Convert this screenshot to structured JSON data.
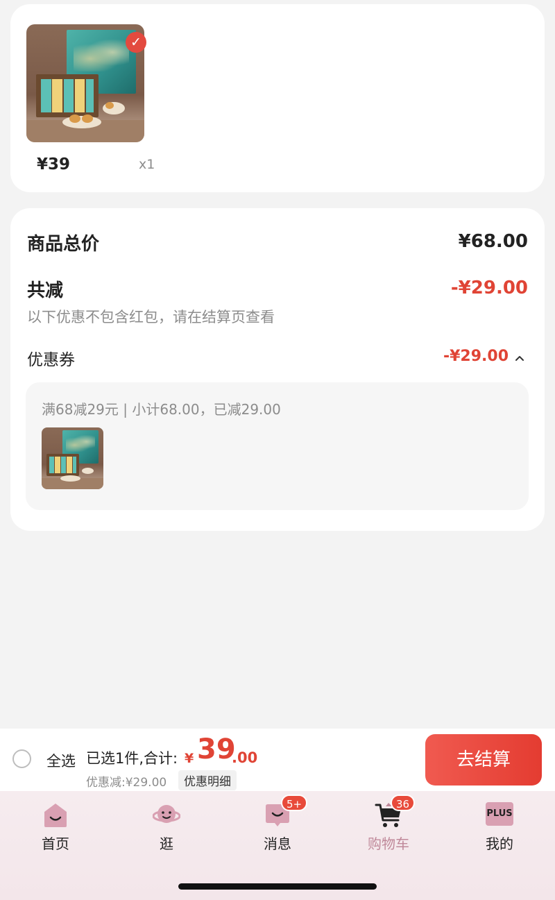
{
  "item": {
    "price": "¥39",
    "quantity": "x1",
    "checkmark": "✓"
  },
  "summary": {
    "total_label": "商品总价",
    "total_value": "¥68.00",
    "discount_label": "共减",
    "discount_value": "-¥29.00",
    "note": "以下优惠不包含红包，请在结算页查看",
    "coupon_label": "优惠券",
    "coupon_value": "-¥29.00",
    "coupon_detail": "满68减29元 | 小计68.00，已减29.00"
  },
  "checkout": {
    "select_all": "全选",
    "selected_text": "已选1件,合计:",
    "currency": "¥",
    "total_int": "39",
    "total_dec": ".00",
    "discount_text": "优惠减:¥29.00",
    "detail_label": "优惠明细",
    "button_label": "去结算"
  },
  "tabs": [
    {
      "label": "首页",
      "icon": "home-icon"
    },
    {
      "label": "逛",
      "icon": "planet-icon"
    },
    {
      "label": "消息",
      "icon": "message-icon",
      "badge": "5+"
    },
    {
      "label": "购物车",
      "icon": "cart-icon",
      "badge": "36",
      "active": true
    },
    {
      "label": "我的",
      "icon": "plus-member-icon",
      "icon_text": "PLUS"
    }
  ],
  "colors": {
    "accent_red": "#e04435",
    "active_tab": "#c0899a",
    "background": "#f3f3f3"
  }
}
